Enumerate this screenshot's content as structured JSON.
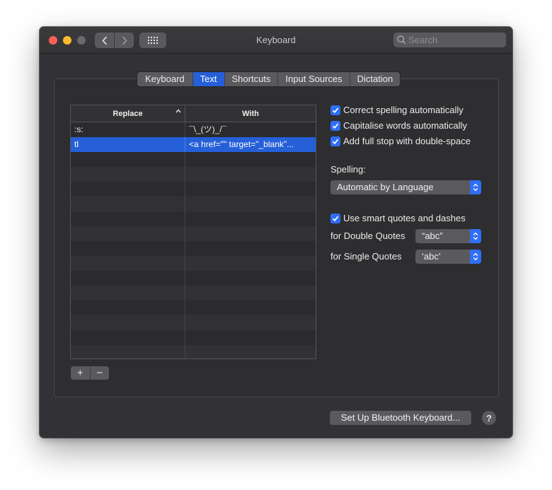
{
  "window": {
    "title": "Keyboard",
    "search_placeholder": "Search"
  },
  "tabs": [
    {
      "label": "Keyboard",
      "active": false
    },
    {
      "label": "Text",
      "active": true
    },
    {
      "label": "Shortcuts",
      "active": false
    },
    {
      "label": "Input Sources",
      "active": false
    },
    {
      "label": "Dictation",
      "active": false
    }
  ],
  "table": {
    "col_replace": "Replace",
    "col_with": "With",
    "rows": [
      {
        "replace": ":s:",
        "with": "¯\\_(ツ)_/¯",
        "selected": false
      },
      {
        "replace": "tl",
        "with": "<a href=\"\" target=\"_blank\"...",
        "selected": true
      }
    ]
  },
  "add_label": "+",
  "remove_label": "−",
  "options": {
    "correct_spelling": {
      "label": "Correct spelling automatically",
      "checked": true
    },
    "capitalise": {
      "label": "Capitalise words automatically",
      "checked": true
    },
    "full_stop": {
      "label": "Add full stop with double-space",
      "checked": true
    },
    "spelling_label": "Spelling:",
    "spelling_value": "Automatic by Language",
    "smart_quotes": {
      "label": "Use smart quotes and dashes",
      "checked": true
    },
    "double_quotes_label": "for Double Quotes",
    "double_quotes_value": "“abc”",
    "single_quotes_label": "for Single Quotes",
    "single_quotes_value": "‘abc’"
  },
  "bluetooth_button": "Set Up Bluetooth Keyboard...",
  "help_label": "?",
  "colors": {
    "accent": "#2560d8",
    "window_bg": "#323236",
    "close": "#fe5f57",
    "minimize": "#febc2e"
  }
}
